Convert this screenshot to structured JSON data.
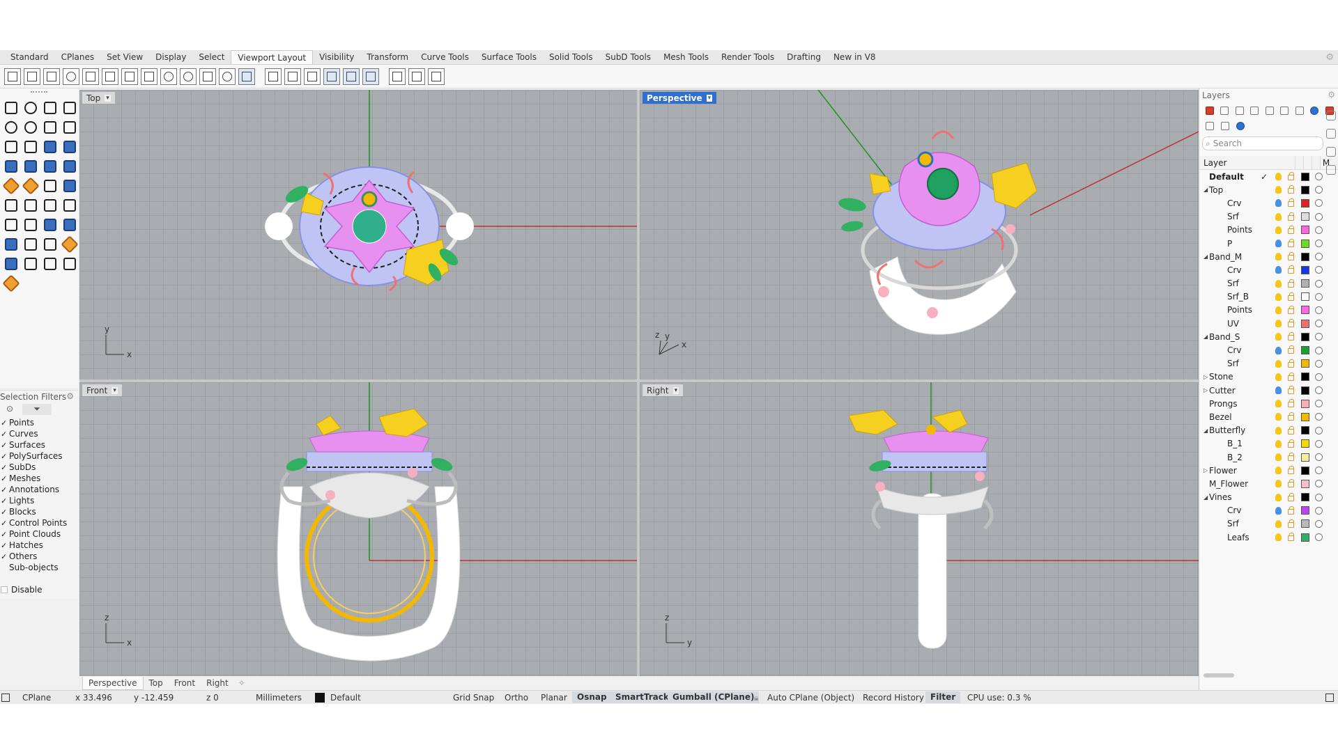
{
  "tabs": [
    "Standard",
    "CPlanes",
    "Set View",
    "Display",
    "Select",
    "Viewport Layout",
    "Visibility",
    "Transform",
    "Curve Tools",
    "Surface Tools",
    "Solid Tools",
    "SubD Tools",
    "Mesh Tools",
    "Render Tools",
    "Drafting",
    "New in V8"
  ],
  "active_tab_index": 5,
  "tab_settings_icon": "gear-icon",
  "selection_filters": {
    "title": "Selection Filters",
    "items": [
      {
        "label": "Points",
        "checked": true
      },
      {
        "label": "Curves",
        "checked": true
      },
      {
        "label": "Surfaces",
        "checked": true
      },
      {
        "label": "PolySurfaces",
        "checked": true
      },
      {
        "label": "SubDs",
        "checked": true
      },
      {
        "label": "Meshes",
        "checked": true
      },
      {
        "label": "Annotations",
        "checked": true
      },
      {
        "label": "Lights",
        "checked": true
      },
      {
        "label": "Blocks",
        "checked": true
      },
      {
        "label": "Control Points",
        "checked": true
      },
      {
        "label": "Point Clouds",
        "checked": true
      },
      {
        "label": "Hatches",
        "checked": true
      },
      {
        "label": "Others",
        "checked": true
      },
      {
        "label": "Sub-objects",
        "checked": false
      }
    ],
    "disable_label": "Disable",
    "check_glyph": "✓"
  },
  "viewports": {
    "top": {
      "label": "Top",
      "axis1": "y",
      "axis2": "x"
    },
    "perspective": {
      "label": "Perspective",
      "axis1": "z",
      "axis2": "x",
      "axis3": "y"
    },
    "front": {
      "label": "Front",
      "axis1": "z",
      "axis2": "x"
    },
    "right": {
      "label": "Right",
      "axis1": "z",
      "axis2": "y"
    },
    "dropdown_glyph": "▾"
  },
  "layout_tabs": [
    "Perspective",
    "Top",
    "Front",
    "Right"
  ],
  "layout_tab_add": "✧",
  "layers": {
    "title": "Layers",
    "search_placeholder": "Search",
    "search_icon": "⌕",
    "header_layer": "Layer",
    "header_material": "M",
    "rows": [
      {
        "name": "Default",
        "level": 0,
        "bold": true,
        "current": true,
        "color": "#000000",
        "bulb": "#f5c518"
      },
      {
        "name": "Top",
        "level": 0,
        "expand": "open",
        "color": "#000000",
        "bulb": "#f5c518"
      },
      {
        "name": "Crv",
        "level": 1,
        "color": "#e02020",
        "bulb": "#4a90e2"
      },
      {
        "name": "Srf",
        "level": 1,
        "color": "#dedede",
        "bulb": "#f5c518"
      },
      {
        "name": "Points",
        "level": 1,
        "color": "#ff66dd",
        "bulb": "#f5c518"
      },
      {
        "name": "P",
        "level": 1,
        "color": "#66dd22",
        "bulb": "#4a90e2"
      },
      {
        "name": "Band_M",
        "level": 0,
        "expand": "open",
        "color": "#000000",
        "bulb": "#f5c518"
      },
      {
        "name": "Crv",
        "level": 1,
        "color": "#1a36e0",
        "bulb": "#4a90e2"
      },
      {
        "name": "Srf",
        "level": 1,
        "color": "#b0b0b0",
        "bulb": "#f5c518"
      },
      {
        "name": "Srf_B",
        "level": 1,
        "color": "#ffffff",
        "bulb": "#f5c518"
      },
      {
        "name": "Points",
        "level": 1,
        "color": "#ff66dd",
        "bulb": "#f5c518"
      },
      {
        "name": "UV",
        "level": 1,
        "color": "#f07070",
        "bulb": "#f5c518"
      },
      {
        "name": "Band_S",
        "level": 0,
        "expand": "open",
        "color": "#000000",
        "bulb": "#f5c518"
      },
      {
        "name": "Crv",
        "level": 1,
        "color": "#18a030",
        "bulb": "#4a90e2"
      },
      {
        "name": "Srf",
        "level": 1,
        "color": "#f5b800",
        "bulb": "#f5c518"
      },
      {
        "name": "Stone",
        "level": 0,
        "expand": "closed",
        "color": "#000000",
        "bulb": "#f5c518"
      },
      {
        "name": "Cutter",
        "level": 0,
        "expand": "closed",
        "color": "#000000",
        "bulb": "#4a90e2"
      },
      {
        "name": "Prongs",
        "level": 0,
        "color": "#f7b0b0",
        "bulb": "#f5c518"
      },
      {
        "name": "Bezel",
        "level": 0,
        "color": "#f5b800",
        "bulb": "#f5c518"
      },
      {
        "name": "Butterfly",
        "level": 0,
        "expand": "open",
        "color": "#000000",
        "bulb": "#f5c518"
      },
      {
        "name": "B_1",
        "level": 1,
        "color": "#f5d800",
        "bulb": "#f5c518"
      },
      {
        "name": "B_2",
        "level": 1,
        "color": "#f5f0a0",
        "bulb": "#f5c518"
      },
      {
        "name": "Flower",
        "level": 0,
        "expand": "closed",
        "color": "#000000",
        "bulb": "#f5c518"
      },
      {
        "name": "M_Flower",
        "level": 0,
        "color": "#f7c0c8",
        "bulb": "#f5c518"
      },
      {
        "name": "Vines",
        "level": 0,
        "expand": "open",
        "color": "#000000",
        "bulb": "#f5c518"
      },
      {
        "name": "Crv",
        "level": 1,
        "color": "#c040f0",
        "bulb": "#4a90e2"
      },
      {
        "name": "Srf",
        "level": 1,
        "color": "#b8b8b8",
        "bulb": "#f5c518"
      },
      {
        "name": "Leafs",
        "level": 1,
        "color": "#30b060",
        "bulb": "#f5c518"
      }
    ]
  },
  "status": {
    "cplane": "CPlane",
    "x": "x 33.496",
    "y": "y -12.459",
    "z": "z 0",
    "units": "Millimeters",
    "layer": "Default",
    "grid_snap": "Grid Snap",
    "ortho": "Ortho",
    "planar": "Planar",
    "osnap": "Osnap",
    "smarttrack": "SmartTrack",
    "gumball": "Gumball (CPlane)",
    "auto_cplane": "Auto CPlane (Object)",
    "record_history": "Record History",
    "filter": "Filter",
    "cpu": "CPU use: 0.3 %"
  },
  "colors": {
    "active_viewport": "#2f6fd0",
    "x_axis": "#c03030",
    "y_axis": "#209020",
    "model_white": "#ffffff",
    "model_pink": "#e890f0",
    "model_yellow": "#f5d020",
    "model_green": "#30b060",
    "model_lavender": "#b0b8f0"
  }
}
